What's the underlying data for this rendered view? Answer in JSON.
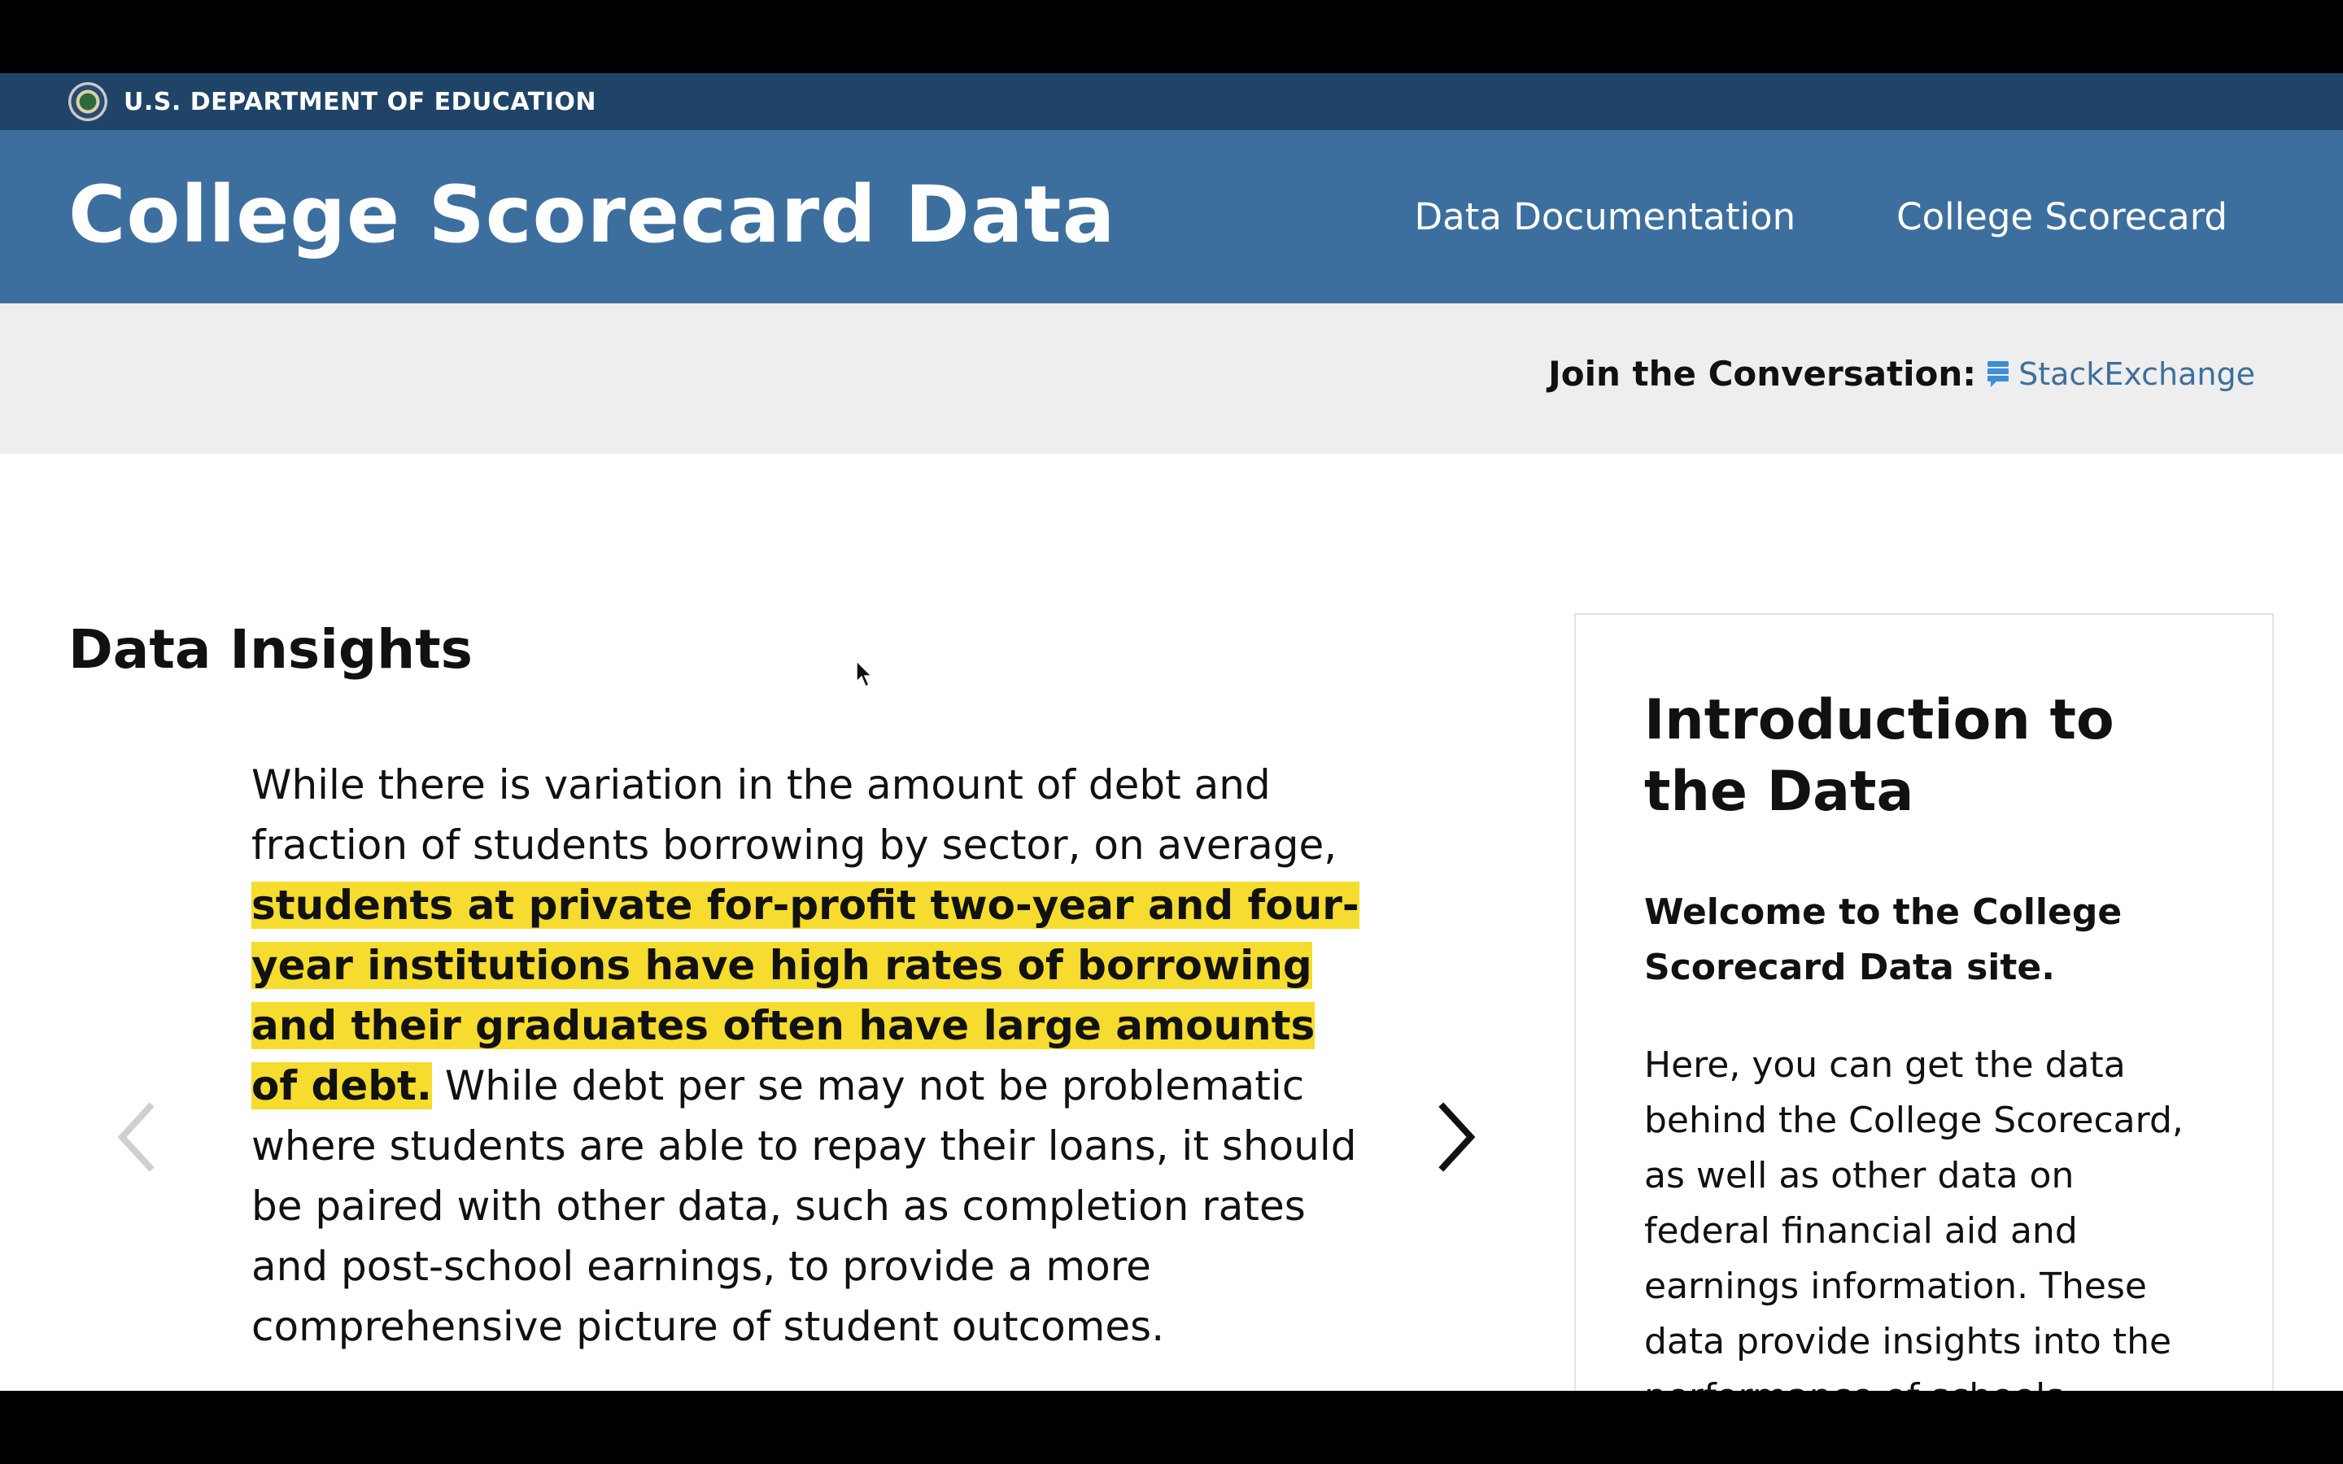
{
  "gov_bar": {
    "label": "U.S. DEPARTMENT OF EDUCATION"
  },
  "header": {
    "title": "College Scorecard Data",
    "nav": [
      "Data Documentation",
      "College Scorecard"
    ]
  },
  "conversation": {
    "label": "Join the Conversation:",
    "link": "StackExchange"
  },
  "insights": {
    "title": "Data Insights",
    "text_before": "While there is variation in the amount of debt and fraction of students borrowing by sector, on average,",
    "highlight": "students at private for-profit two-year and four-year institutions have high rates of borrowing and their graduates often have large amounts of debt.",
    "text_after": "While debt per se may not be problematic where students are able to repay their loans, it should be paired with other data, such as completion rates and post-school earnings, to provide a more comprehensive picture of student outcomes."
  },
  "intro": {
    "title": "Introduction to the Data",
    "welcome": "Welcome to the College Scorecard Data site.",
    "body": "Here, you can get the data behind the College Scorecard, as well as other data on federal financial aid and earnings information. These data provide insights into the performance of schools"
  },
  "colors": {
    "gov_bar": "#1f4468",
    "header": "#3d6f9e",
    "highlight": "#f5dc2e",
    "convo_bar": "#eeeeee"
  },
  "icons": [
    "seal-icon",
    "stackexchange-icon",
    "chevron-left-icon",
    "chevron-right-icon",
    "mouse-cursor-icon"
  ]
}
